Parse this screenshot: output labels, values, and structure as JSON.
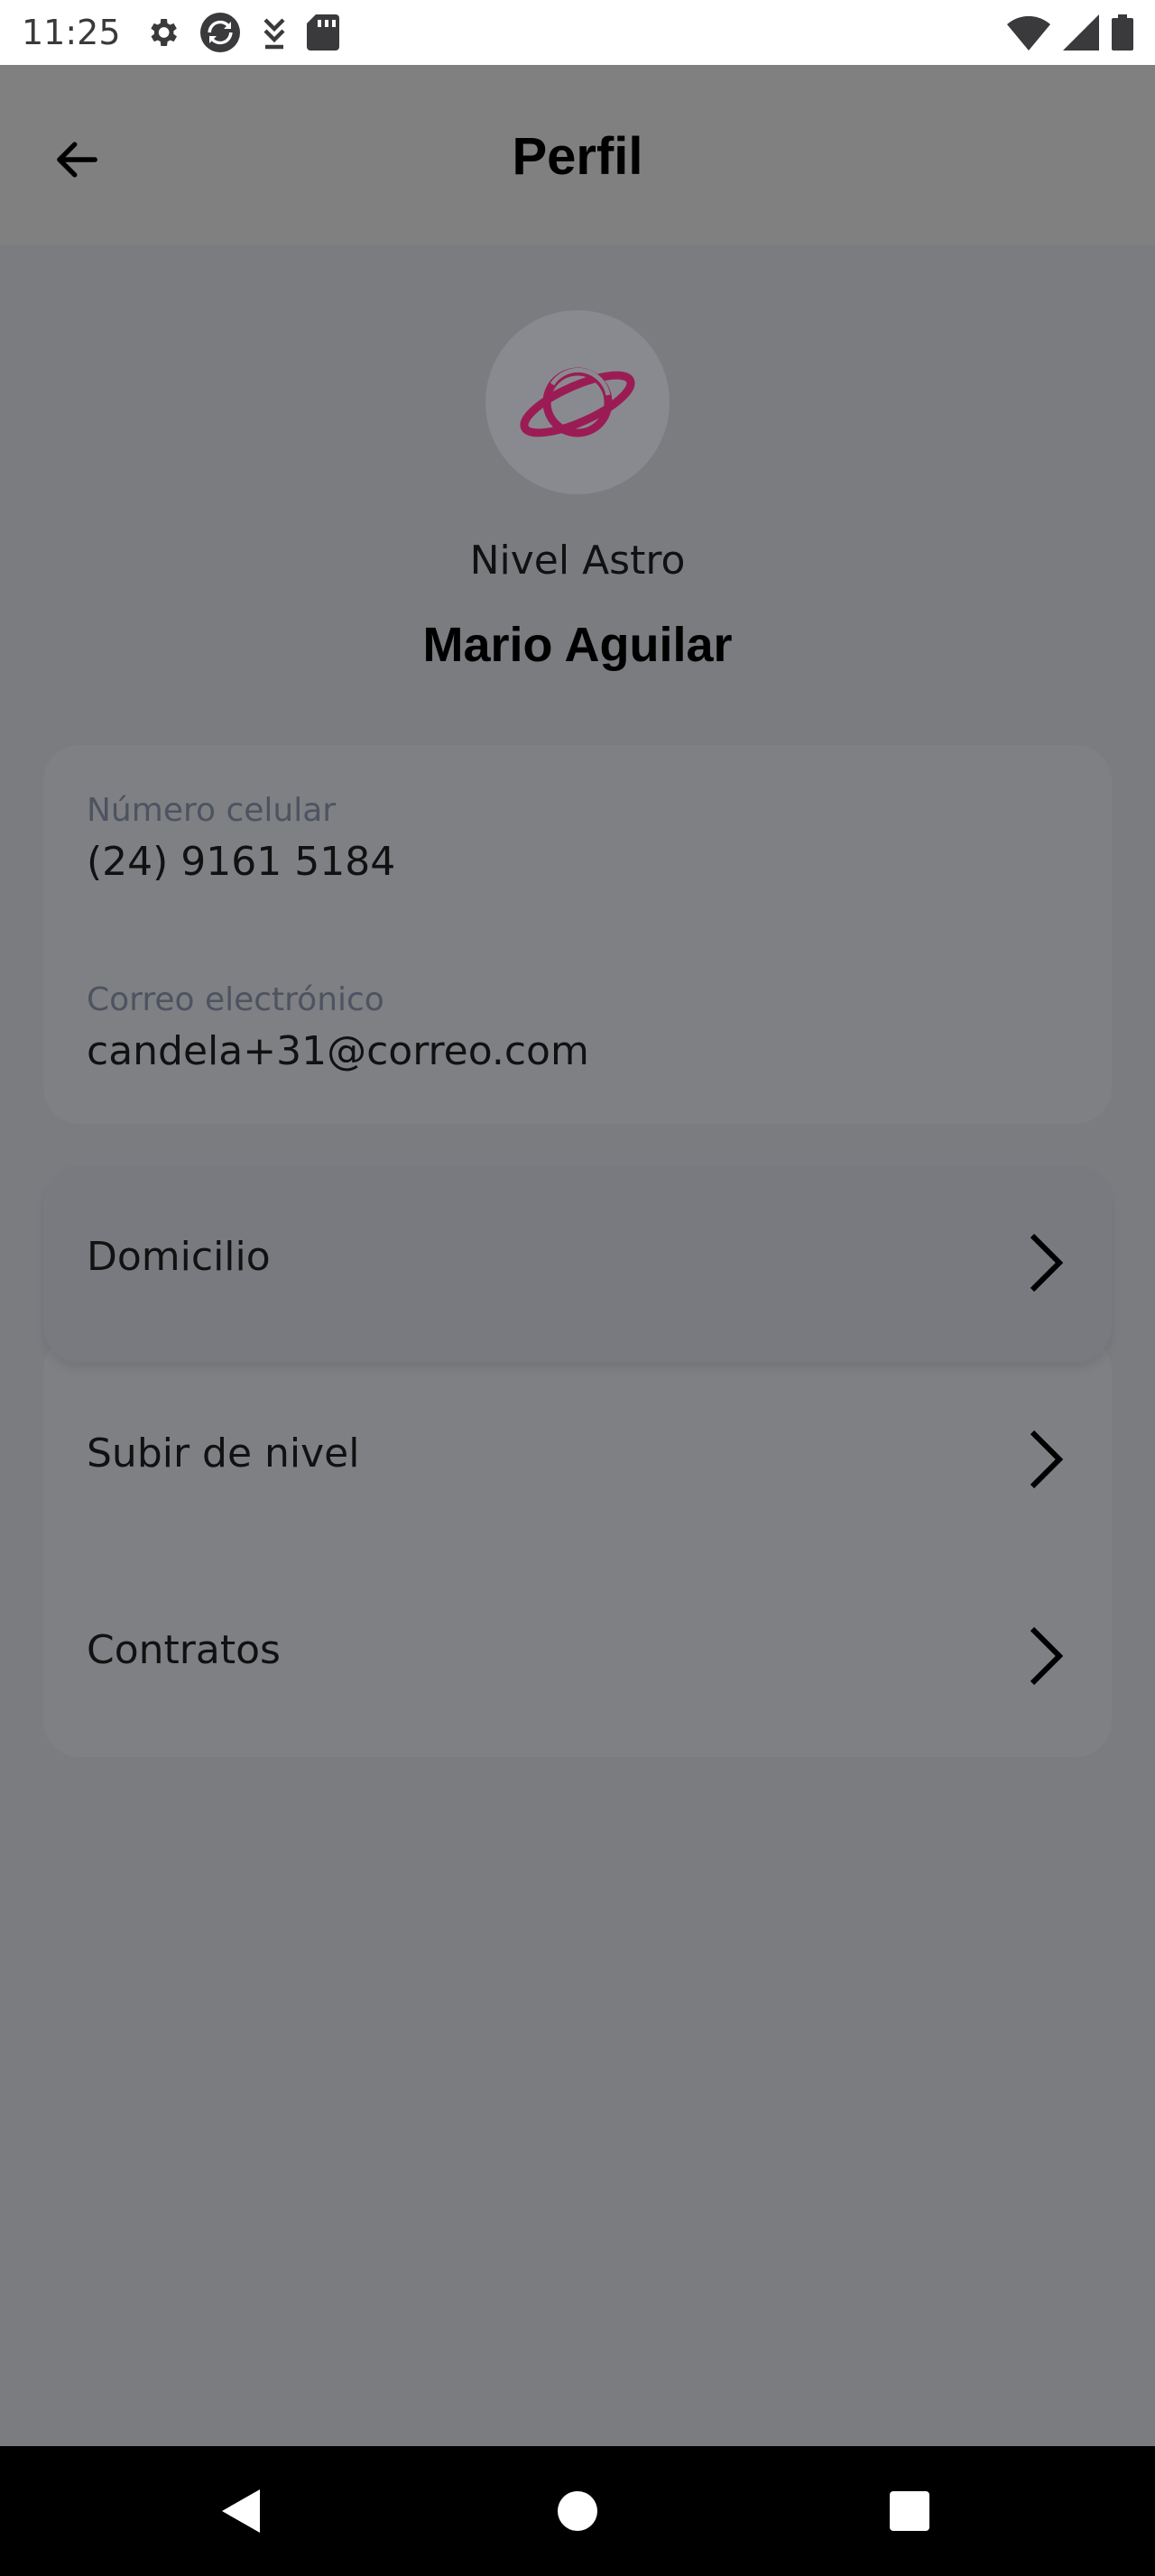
{
  "status_bar": {
    "time": "11:25",
    "left_icons": [
      "gear-icon",
      "sync-icon",
      "download-icon",
      "sd-card-icon"
    ],
    "right_icons": [
      "wifi-icon",
      "signal-icon",
      "battery-icon"
    ]
  },
  "app_bar": {
    "back_icon": "arrow-left-icon",
    "title": "Perfil"
  },
  "profile": {
    "avatar_icon": "planet-icon",
    "accent_color": "#9b1c55",
    "level": "Nivel Astro",
    "name": "Mario Aguilar"
  },
  "contact": {
    "phone_label": "Número celular",
    "phone_value": "(24) 9161 5184",
    "email_label": "Correo electrónico",
    "email_value": "candela+31@correo.com"
  },
  "menu": {
    "items": [
      {
        "label": "Domicilio",
        "icon": "chevron-right-icon"
      },
      {
        "label": "Subir de nivel",
        "icon": "chevron-right-icon"
      },
      {
        "label": "Contratos",
        "icon": "chevron-right-icon"
      }
    ]
  },
  "nav_bar": {
    "buttons": [
      "back-triangle-icon",
      "home-circle-icon",
      "recents-square-icon"
    ]
  }
}
